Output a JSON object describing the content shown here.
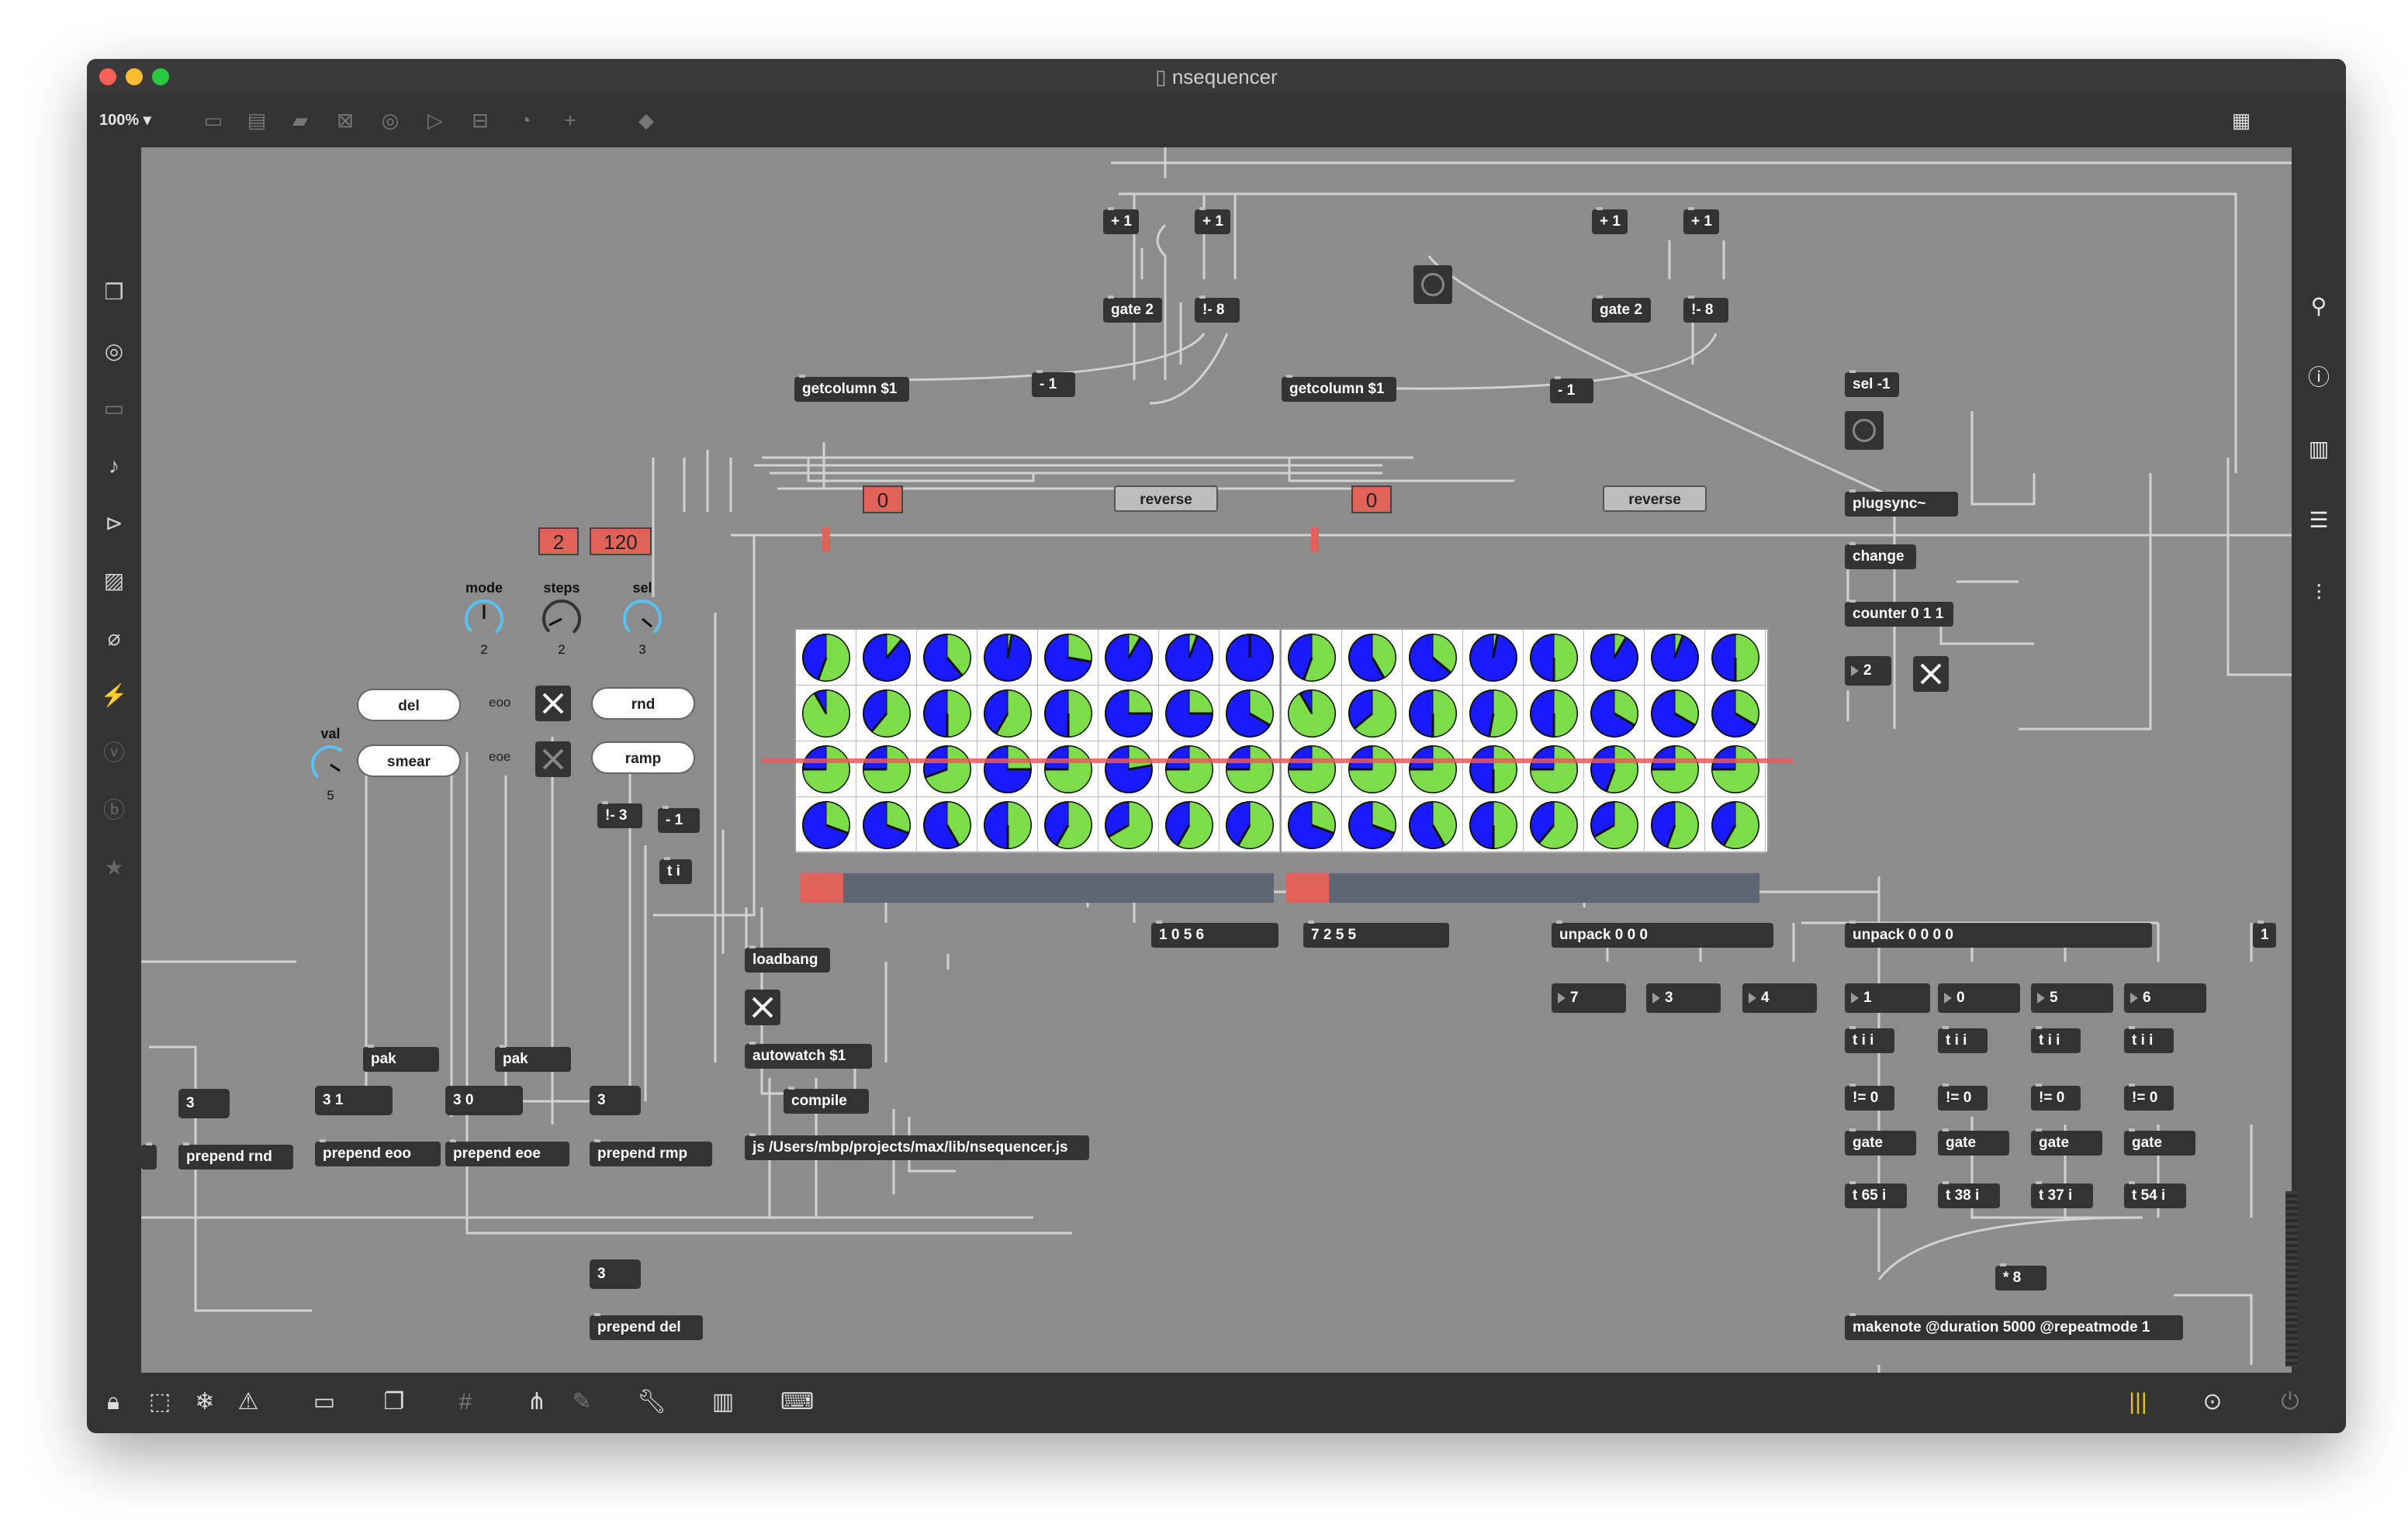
{
  "window": {
    "title": "nsequencer",
    "zoom": "100%"
  },
  "toolbar_icons": [
    "presentation-view-icon",
    "comment-icon",
    "speech-icon",
    "toggle-icon",
    "bang-icon",
    "play-icon",
    "slider-icon",
    "dial-icon",
    "add-icon",
    "paint-bucket-icon",
    "grid-menu-icon"
  ],
  "left_sidebar": [
    "package-icon",
    "target-icon",
    "vst-icon",
    "music-note-icon",
    "media-icon",
    "image-icon",
    "clip-icon",
    "plugin-icon",
    "vizzie-icon",
    "bpatcher-icon",
    "star-icon"
  ],
  "right_sidebar": [
    "search-icon",
    "info-icon",
    "columns-icon",
    "list-icon",
    "sliders-icon"
  ],
  "bottom_bar": [
    "lock-icon",
    "edit-icon",
    "freeze-icon",
    "warning-icon",
    "presentation-icon",
    "layers-icon",
    "grid-icon",
    "tree-icon",
    "tool-icon",
    "wrench-icon",
    "piano-icon",
    "keyboard-icon",
    "meter-icon",
    "play-icon",
    "power-icon"
  ],
  "objects": {
    "plus1_a": "+ 1",
    "plus1_b": "+ 1",
    "plus1_c": "+ 1",
    "plus1_d": "+ 1",
    "gate2_a": "gate 2",
    "gate2_b": "gate 2",
    "rminus8_a": "!- 8",
    "rminus8_b": "!- 8",
    "minus1_a": "- 1",
    "minus1_b": "- 1",
    "getcolumn_a": "getcolumn $1",
    "getcolumn_b": "getcolumn $1",
    "sel": "sel -1",
    "plugsync": "plugsync~",
    "change": "change",
    "counter": "counter 0 1 1",
    "rminus3": "!- 3",
    "minus1_c": "- 1",
    "ti": "t i",
    "loadbang": "loadbang",
    "autowatch": "autowatch $1",
    "compile": "compile",
    "js": "js /Users/mbp/projects/max/lib/nsequencer.js",
    "pak_a": "pak",
    "pak_b": "pak",
    "prepend_rnd": "prepend rnd",
    "prepend_eoo": "prepend eoo",
    "prepend_eoe": "prepend eoe",
    "prepend_rmp": "prepend rmp",
    "prepend_del": "prepend del",
    "unpack3": "unpack 0 0 0",
    "unpack4": "unpack 0 0 0 0",
    "tii_a": "t i i",
    "tii_b": "t i i",
    "tii_c": "t i i",
    "tii_d": "t i i",
    "neq_a": "!= 0",
    "neq_b": "!= 0",
    "neq_c": "!= 0",
    "neq_d": "!= 0",
    "gate_a": "gate",
    "gate_b": "gate",
    "gate_c": "gate",
    "gate_d": "gate",
    "t65": "t 65 i",
    "t38": "t 38 i",
    "t37": "t 37 i",
    "t54": "t 54 i",
    "times8": "* 8",
    "makenote": "makenote @duration 5000 @repeatmode 1"
  },
  "messages": {
    "reverse_a": "reverse",
    "reverse_b": "reverse"
  },
  "pills": {
    "del": "del",
    "smear": "smear",
    "rnd": "rnd",
    "ramp": "ramp"
  },
  "labels": {
    "eoo": "eoo",
    "eoe": "eoe"
  },
  "red_numbers": {
    "steps_val": "2",
    "tempo_val": "120",
    "grid1_val": "0",
    "grid2_val": "0"
  },
  "dials": [
    {
      "label": "mode",
      "value": "2"
    },
    {
      "label": "steps",
      "value": "2"
    },
    {
      "label": "sel",
      "value": "3"
    },
    {
      "label": "val",
      "value": "5"
    }
  ],
  "numbers": {
    "n3_a": "3",
    "n31": "3 1",
    "n30": "3 0",
    "n3_b": "3",
    "n3_c": "3",
    "list1": "1 0 5 6",
    "list2": "7 2 5 5",
    "counter_out": "2",
    "u3_1": "7",
    "u3_2": "3",
    "u3_3": "4",
    "u4_1": "1",
    "u4_2": "0",
    "u4_3": "5",
    "u4_4": "6",
    "edge": "1"
  },
  "colors": {
    "canvas": "#8c8c8c",
    "dial_fill": "#1a1aff",
    "dial_accent": "#7ddc4a",
    "red_box": "#e06259",
    "slider_track": "#5d6672"
  },
  "sequencer": {
    "rows": 4,
    "cols": 8,
    "grid1_angles": [
      [
        200,
        40,
        140,
        10,
        100,
        30,
        20,
        0
      ],
      [
        330,
        220,
        180,
        210,
        180,
        90,
        90,
        120
      ],
      [
        270,
        270,
        250,
        90,
        270,
        80,
        270,
        270
      ],
      [
        110,
        110,
        150,
        180,
        210,
        240,
        210,
        210
      ]
    ],
    "grid2_angles": [
      [
        200,
        150,
        130,
        10,
        180,
        30,
        20,
        180
      ],
      [
        330,
        230,
        180,
        190,
        180,
        120,
        120,
        120
      ],
      [
        270,
        270,
        270,
        180,
        270,
        200,
        270,
        270
      ],
      [
        110,
        110,
        150,
        180,
        220,
        240,
        200,
        210
      ]
    ],
    "grid1_slider": 0.09,
    "grid2_slider": 0.09
  }
}
